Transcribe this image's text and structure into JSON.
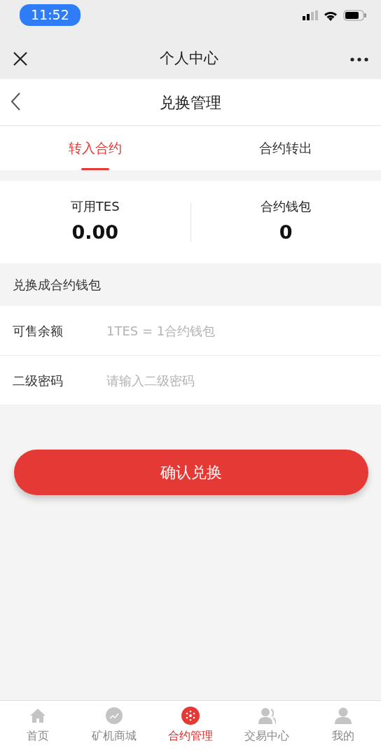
{
  "status_bar": {
    "time": "11:52"
  },
  "wechat_bar": {
    "title": "个人中心"
  },
  "header": {
    "title": "兑换管理"
  },
  "tabs": [
    {
      "label": "转入合约",
      "selected": true
    },
    {
      "label": "合约转出",
      "selected": false
    }
  ],
  "stats": [
    {
      "label": "可用TES",
      "value": "0.00"
    },
    {
      "label": "合约钱包",
      "value": "0"
    }
  ],
  "section_title": "兑换成合约钱包",
  "fields": [
    {
      "label": "可售余额",
      "placeholder": "1TES = 1合约钱包"
    },
    {
      "label": "二级密码",
      "placeholder": "请输入二级密码"
    }
  ],
  "submit": "确认兑换",
  "bottom_nav": [
    {
      "label": "首页",
      "kind": "home",
      "selected": false
    },
    {
      "label": "矿机商城",
      "kind": "shop",
      "selected": false
    },
    {
      "label": "合约管理",
      "kind": "contract",
      "selected": true
    },
    {
      "label": "交易中心",
      "kind": "trade",
      "selected": false
    },
    {
      "label": "我的",
      "kind": "user",
      "selected": false
    }
  ]
}
